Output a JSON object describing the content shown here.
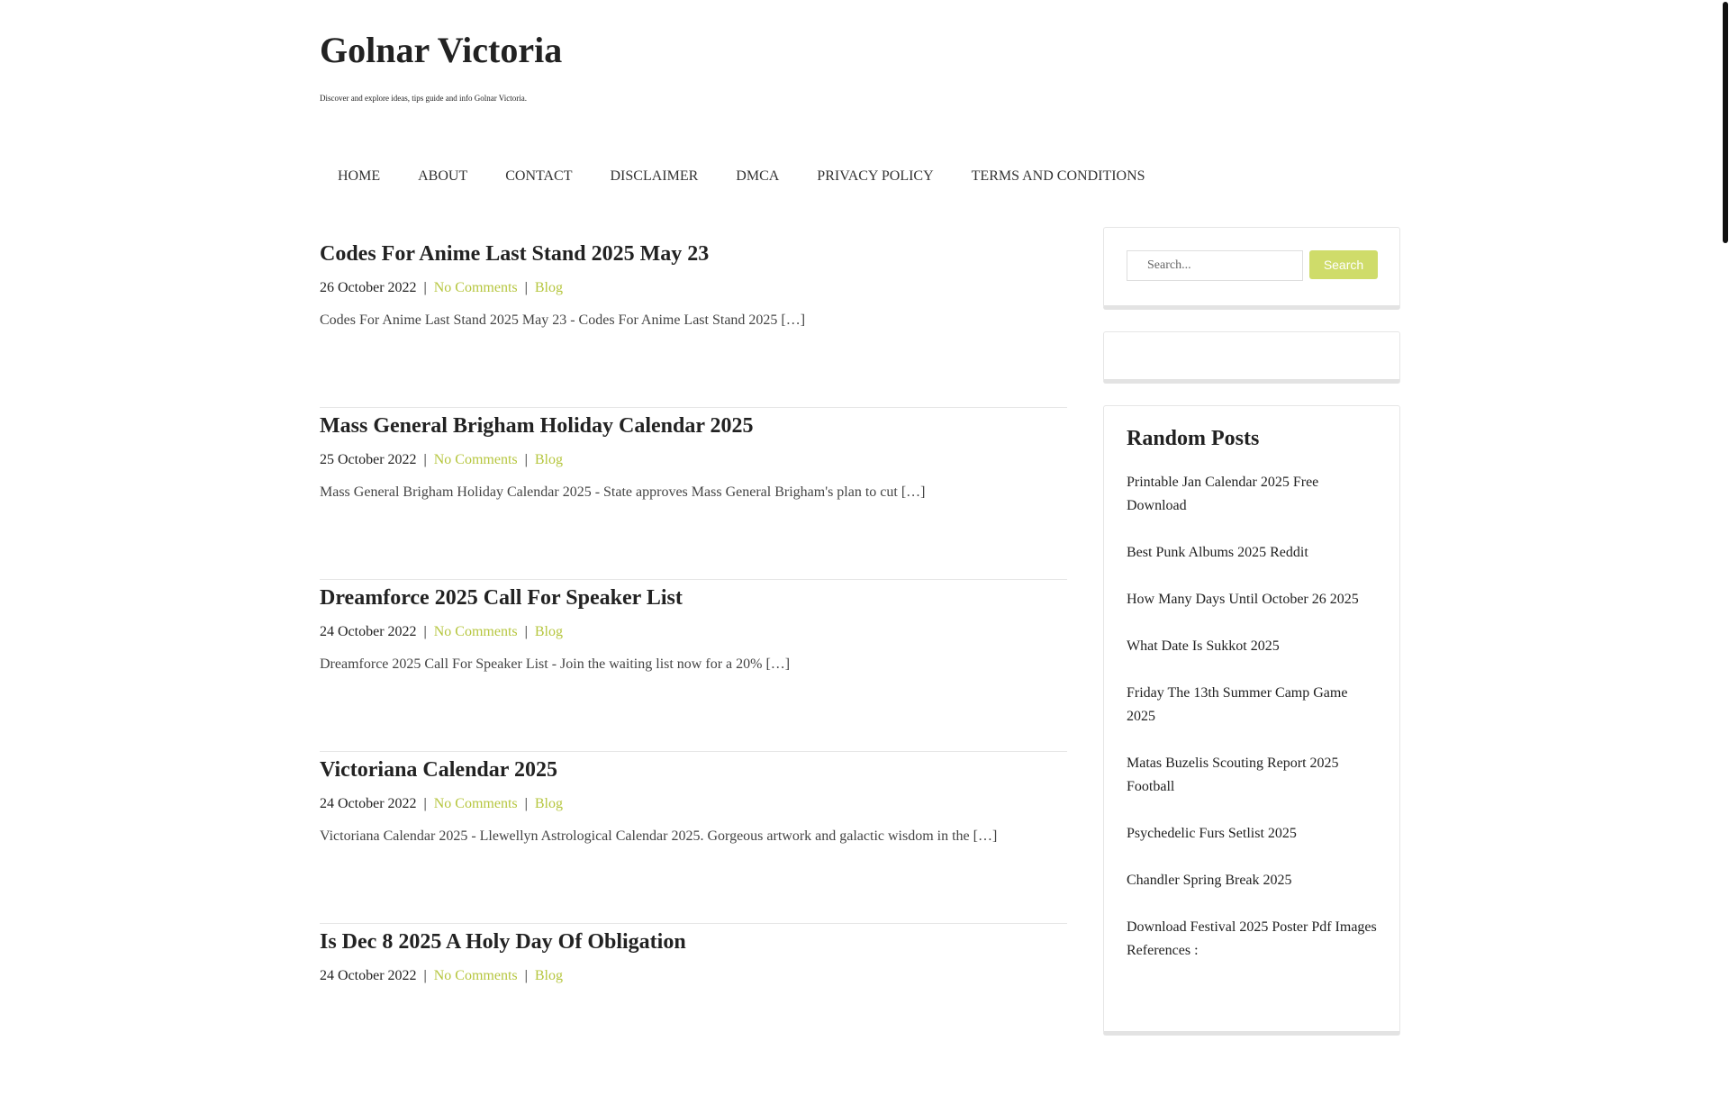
{
  "site": {
    "title": "Golnar Victoria",
    "description": "Discover and explore ideas, tips guide and info Golnar Victoria."
  },
  "nav": [
    "HOME",
    "ABOUT",
    "CONTACT",
    "DISCLAIMER",
    "DMCA",
    "PRIVACY POLICY",
    "TERMS AND CONDITIONS"
  ],
  "posts": [
    {
      "title": "Codes For Anime Last Stand 2025 May 23",
      "date": "26 October 2022",
      "comments": "No Comments",
      "category": "Blog",
      "excerpt": "Codes For Anime Last Stand 2025 May 23 - Codes For Anime Last Stand 2025 […]"
    },
    {
      "title": "Mass General Brigham Holiday Calendar 2025",
      "date": "25 October 2022",
      "comments": "No Comments",
      "category": "Blog",
      "excerpt": "Mass General Brigham Holiday Calendar 2025 - State approves Mass General Brigham's plan to cut […]"
    },
    {
      "title": "Dreamforce 2025 Call For Speaker List",
      "date": "24 October 2022",
      "comments": "No Comments",
      "category": "Blog",
      "excerpt": "Dreamforce 2025 Call For Speaker List - Join the waiting list now for a 20% […]"
    },
    {
      "title": "Victoriana Calendar 2025",
      "date": "24 October 2022",
      "comments": "No Comments",
      "category": "Blog",
      "excerpt": "Victoriana Calendar 2025 - Llewellyn Astrological Calendar 2025. Gorgeous artwork and galactic wisdom in the […]"
    },
    {
      "title": "Is Dec 8 2025 A Holy Day Of Obligation",
      "date": "24 October 2022",
      "comments": "No Comments",
      "category": "Blog",
      "excerpt": ""
    }
  ],
  "meta_separator": "|",
  "sidebar": {
    "search": {
      "placeholder": "Search...",
      "button_label": "Search"
    },
    "random_posts": {
      "title": "Random Posts",
      "items": [
        "Printable Jan Calendar 2025 Free Download",
        "Best Punk Albums 2025 Reddit",
        "How Many Days Until October 26 2025",
        "What Date Is Sukkot 2025",
        "Friday The 13th Summer Camp Game 2025",
        "Matas Buzelis Scouting Report 2025 Football",
        "Psychedelic Furs Setlist 2025",
        "Chandler Spring Break 2025",
        "Download Festival 2025 Poster Pdf Images References :"
      ]
    }
  },
  "colors": {
    "link_accent": "#b6c63f",
    "search_button": "#cfdc6a"
  }
}
